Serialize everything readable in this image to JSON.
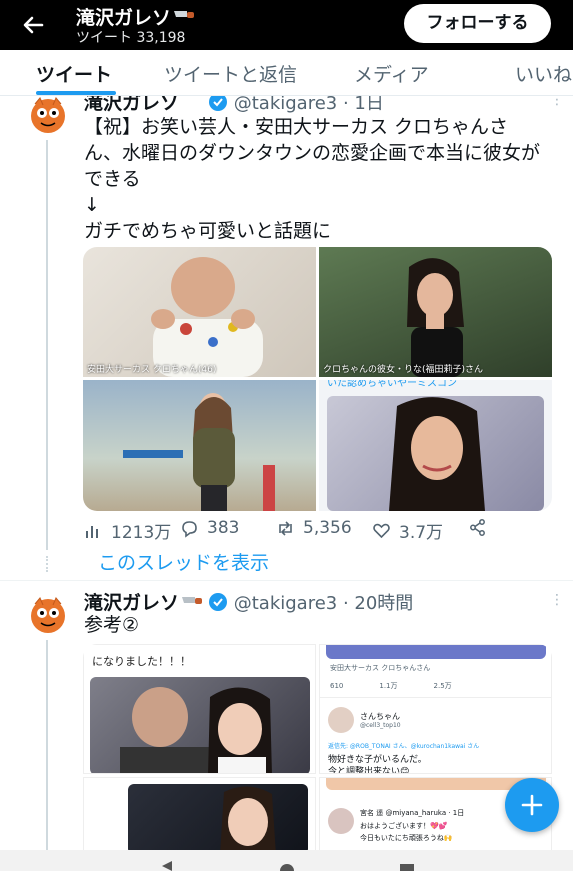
{
  "header": {
    "title": "滝沢ガレソ",
    "subtitle": "ツイート 33,198",
    "follow_label": "フォローする"
  },
  "tabs": [
    {
      "label": "ツイート"
    },
    {
      "label": "ツイートと返信"
    },
    {
      "label": "メディア"
    },
    {
      "label": "いいね"
    }
  ],
  "tweet1": {
    "name": "滝沢ガレソ",
    "handle_time": "@takigare3 · 1日",
    "lines": [
      "【祝】お笑い芸人・安田大サーカス クロちゃんさ",
      "ん、水曜日のダウンタウンの恋愛企画で本当に彼女が",
      "できる",
      "↓",
      "ガチでめちゃ可愛いと話題に"
    ],
    "captions": {
      "img1": "安田大サーカス クロちゃん(46)",
      "img2": "クロちゃんの彼女・りな(福田莉子)さん",
      "img4": "いた認めちゃいやーミスコン"
    },
    "stats": {
      "views": "1213万",
      "replies": "383",
      "retweets": "5,356",
      "likes": "3.7万"
    },
    "show_thread": "このスレッドを表示"
  },
  "tweet2": {
    "name": "滝沢ガレソ",
    "handle_time": "@takigare3 · 20時間",
    "text": "参考②",
    "img1_text": "になりました！！！",
    "img2": {
      "header": "安田大サーカス クロちゃんさん",
      "stats": [
        "610",
        "1.1万",
        "2.5万"
      ],
      "user": "さんちゃん",
      "user_handle": "@cell3_top10",
      "reply_to": "返信先: @ROB_TONAI さん、@kurochan1kawai さん",
      "line1": "物好きな子がいるんだ。",
      "line2": "今と調整出来ない😊"
    },
    "img4": {
      "user": "宮名 遥 @miyana_haruka · 1日",
      "line1": "おはようございます！💖💕",
      "line2": "今日もいたにち頑張ろうね🙌"
    }
  },
  "colors": {
    "accent": "#1d9bf0",
    "header_bg": "#000000",
    "text": "#0f1419",
    "muted": "#536471"
  }
}
